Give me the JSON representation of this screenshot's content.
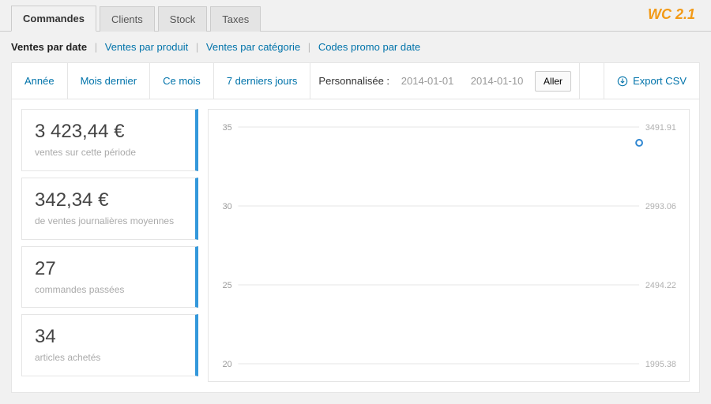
{
  "brand": "WC 2.1",
  "topTabs": [
    "Commandes",
    "Clients",
    "Stock",
    "Taxes"
  ],
  "subnav": {
    "items": [
      "Ventes par date",
      "Ventes par produit",
      "Ventes par catégorie",
      "Codes promo par date"
    ]
  },
  "filters": {
    "tabs": [
      "Année",
      "Mois dernier",
      "Ce mois",
      "7 derniers jours"
    ],
    "customLabel": "Personnalisée :",
    "dateFrom": "2014-01-01",
    "dateTo": "2014-01-10",
    "goLabel": "Aller",
    "exportLabel": "Export CSV"
  },
  "stats": [
    {
      "value": "3 423,44 €",
      "label": "ventes sur cette période"
    },
    {
      "value": "342,34 €",
      "label": "de ventes journalières moyennes"
    },
    {
      "value": "27",
      "label": "commandes passées"
    },
    {
      "value": "34",
      "label": "articles achetés"
    }
  ],
  "chart_data": {
    "type": "line",
    "left_axis": {
      "ticks": [
        35,
        30,
        25,
        20
      ],
      "ylim": [
        20,
        35
      ]
    },
    "right_axis": {
      "ticks": [
        3491.91,
        2993.06,
        2494.22,
        1995.38
      ]
    },
    "points": [
      {
        "x": 9,
        "y_left": 34
      }
    ],
    "x_range_days": 10
  }
}
